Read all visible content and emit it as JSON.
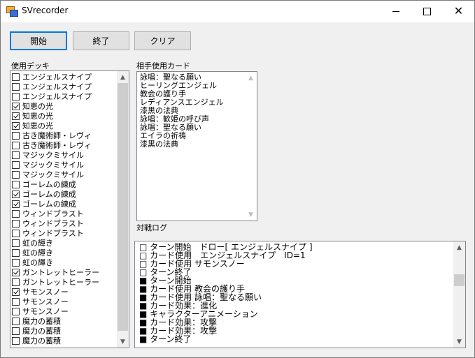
{
  "window": {
    "title": "SVrecorder"
  },
  "titlebar": {
    "close_glyph": "✕"
  },
  "toolbar": {
    "start_label": "開始",
    "end_label": "終了",
    "clear_label": "クリア"
  },
  "deck": {
    "label": "使用デッキ",
    "items": [
      {
        "label": "エンジェルスナイプ",
        "checked": false
      },
      {
        "label": "エンジェルスナイプ",
        "checked": false
      },
      {
        "label": "エンジェルスナイプ",
        "checked": false
      },
      {
        "label": "知恵の光",
        "checked": true
      },
      {
        "label": "知恵の光",
        "checked": true
      },
      {
        "label": "知恵の光",
        "checked": true
      },
      {
        "label": "古き魔術師・レヴィ",
        "checked": false
      },
      {
        "label": "古き魔術師・レヴィ",
        "checked": false
      },
      {
        "label": "マジックミサイル",
        "checked": false
      },
      {
        "label": "マジックミサイル",
        "checked": false
      },
      {
        "label": "マジックミサイル",
        "checked": false
      },
      {
        "label": "ゴーレムの練成",
        "checked": false
      },
      {
        "label": "ゴーレムの練成",
        "checked": true
      },
      {
        "label": "ゴーレムの練成",
        "checked": true
      },
      {
        "label": "ウィンドブラスト",
        "checked": false
      },
      {
        "label": "ウィンドブラスト",
        "checked": false
      },
      {
        "label": "ウィンドブラスト",
        "checked": false
      },
      {
        "label": "虹の輝き",
        "checked": false
      },
      {
        "label": "虹の輝き",
        "checked": false
      },
      {
        "label": "虹の輝き",
        "checked": false
      },
      {
        "label": "ガントレットヒーラー",
        "checked": true
      },
      {
        "label": "ガントレットヒーラー",
        "checked": false
      },
      {
        "label": "サモンスノー",
        "checked": true
      },
      {
        "label": "サモンスノー",
        "checked": false
      },
      {
        "label": "サモンスノー",
        "checked": false
      },
      {
        "label": "魔力の蓄積",
        "checked": false
      },
      {
        "label": "魔力の蓄積",
        "checked": false
      },
      {
        "label": "魔力の蓄積",
        "checked": false
      }
    ]
  },
  "opponent": {
    "label": "相手使用カード",
    "items": [
      "詠唱：聖なる願い",
      "ヒーリングエンジェル",
      "教会の護り手",
      "レディアンスエンジェル",
      "漆黒の法典",
      "詠唱：歓姫の呼び声",
      "詠唱：聖なる願い",
      "エイラの祈祷",
      "漆黒の法典"
    ]
  },
  "log": {
    "label": "対戦ログ",
    "items": [
      "□ ターン開始　ドロー[ エンジェルスナイプ ]",
      "□ カード使用　エンジェルスナイプ　ID=1",
      "□ カード使用 サモンスノー",
      "□ ターン終了",
      "■ ターン開始",
      "■ カード使用 教会の護り手",
      "■ カード使用 詠唱：聖なる願い",
      "■ カード効果：進化",
      "■ キャラクターアニメーション",
      "■ カード効果：攻撃",
      "■ カード効果：攻撃",
      "■ ターン終了"
    ]
  },
  "scroll": {
    "up_arrow": "▲",
    "down_arrow": "▼"
  }
}
